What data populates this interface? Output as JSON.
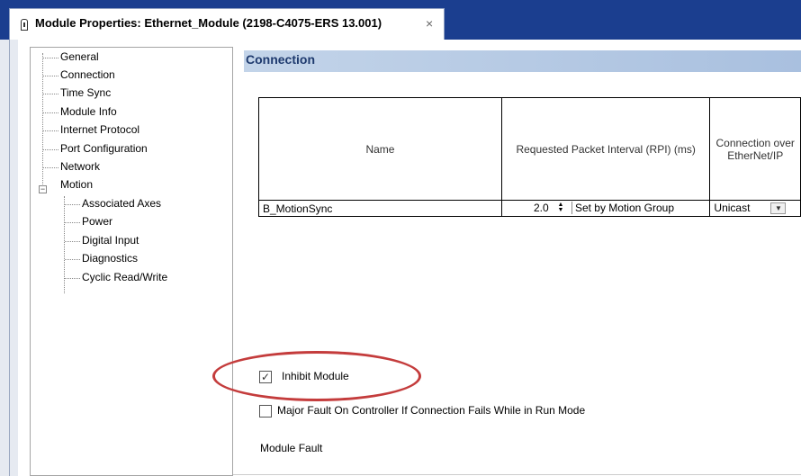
{
  "window": {
    "tab_title": "Module Properties: Ethernet_Module (2198-C4075-ERS 13.001)",
    "close_glyph": "×"
  },
  "tree": {
    "items": [
      {
        "label": "General"
      },
      {
        "label": "Connection"
      },
      {
        "label": "Time Sync"
      },
      {
        "label": "Module Info"
      },
      {
        "label": "Internet Protocol"
      },
      {
        "label": "Port Configuration"
      },
      {
        "label": "Network"
      },
      {
        "label": "Motion",
        "expander": "−"
      },
      {
        "label": "Associated Axes"
      },
      {
        "label": "Power"
      },
      {
        "label": "Digital Input"
      },
      {
        "label": "Diagnostics"
      },
      {
        "label": "Cyclic Read/Write"
      }
    ]
  },
  "section": {
    "title": "Connection"
  },
  "table": {
    "headers": {
      "name": "Name",
      "rpi": "Requested Packet Interval (RPI) (ms)",
      "over": "Connection over EtherNet/IP"
    },
    "row": {
      "name": "B_MotionSync",
      "rpi_value": "2.0",
      "rpi_note": "Set by Motion Group",
      "over": "Unicast"
    }
  },
  "options": {
    "inhibit_label": "Inhibit Module",
    "inhibit_checked": true,
    "major_fault_label": "Major Fault On Controller If Connection Fails While in Run Mode",
    "major_fault_checked": false,
    "module_fault_label": "Module Fault"
  },
  "colors": {
    "titlebar": "#1b3e8f",
    "highlight_ellipse": "#c43c3c",
    "section_header": "#b7cbe4"
  }
}
